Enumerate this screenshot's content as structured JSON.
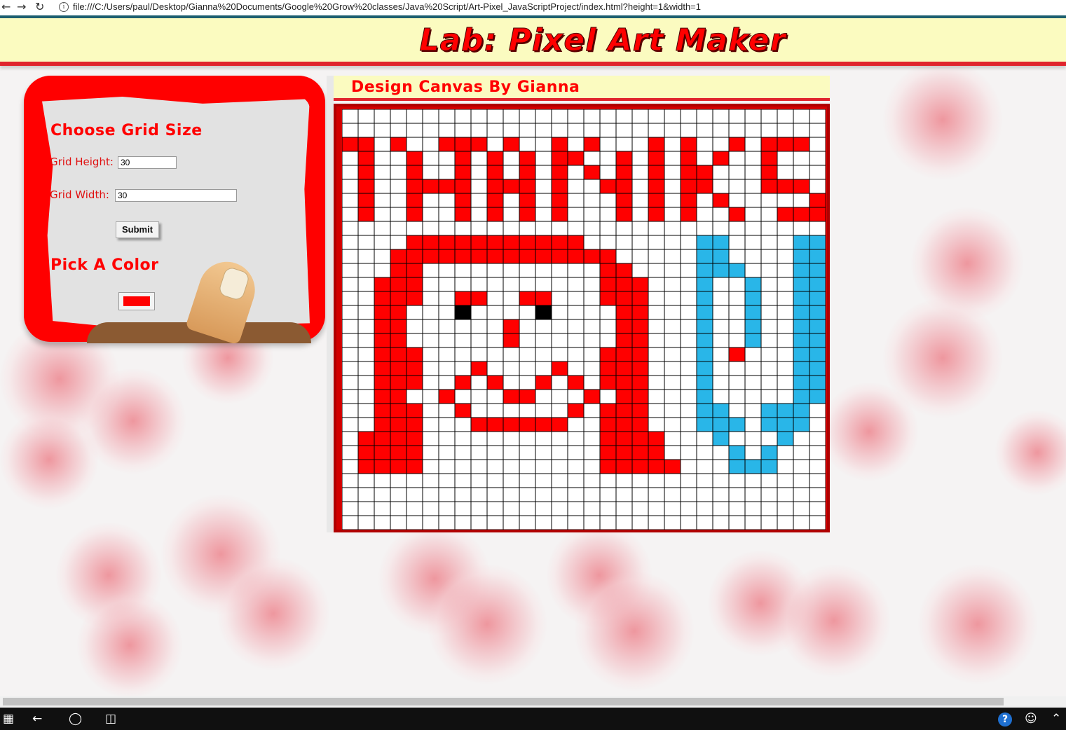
{
  "browser": {
    "url": "file:///C:/Users/paul/Desktop/Gianna%20Documents/Google%20Grow%20classes/Java%20Script/Art-Pixel_JavaScriptProject/index.html?height=1&width=1"
  },
  "header": {
    "title": "Lab: Pixel Art Maker"
  },
  "panel": {
    "grid_size_heading": "Choose Grid Size",
    "height_label": "Grid Height:",
    "height_value": "30",
    "width_label": "Grid Width:",
    "width_value": "30",
    "submit_label": "Submit",
    "color_heading": "Pick A Color",
    "color_value": "#ff0000"
  },
  "canvas": {
    "title": "Design Canvas By Gianna",
    "rows": 30,
    "cols": 30,
    "palette": {
      "r": "#ff0000",
      "b": "#29b6e8",
      "k": "#000000",
      ".": "#ffffff"
    },
    "pixels": [
      "..............................",
      "...............................",
      "rr.r..rrr.r..r.r...r.r..r.rrr.",
      ".r..r..r.r.r.rr..r.r.r.r..r...",
      ".r..r..r.r.r.r.r.r.r.rr...r...",
      ".r..rrrr.rrr.r..rr.r.rr...rrr.",
      ".r..r..r.r.r.r...r.r.r.r.....r",
      ".r..r..r.r.r.r...r.r.r..r..rrr",
      "..............................",
      "....rrrrrrrrrrr.......bb....bb",
      "...rrrrrrrrrrrrrr.....bb....bb",
      "...rr...........rr....bbb...bb",
      "..rrr...........rrr...b..b..bb",
      "..rrr..rr..rr...rrr...b..b..bb",
      "..rr...k....k....rr...b..b..bb",
      "..rr......r......rr...b..b..bb",
      "..rr......r......rr...b..b..bb",
      "..rrr...........rrr...b.r...bb",
      "..rrr...r....r..rrr...b.....bb",
      "..rrr..r.r..r.r.rrr...b.....bb",
      "..rr..r...rr...r.rr...b.....bb",
      "..rrr..r......r.rrr...bb..bbb.",
      "..rrr...rrrrrr..rrr...bbb.bbb.",
      ".rrrr...........rrrr...b...b..",
      ".rrrr...........rrrr....b.b...",
      ".rrrr...........rrrrr...bbb...",
      "..............................",
      "..............................",
      "..............................",
      ".............................."
    ]
  },
  "taskbar": {
    "show": true
  }
}
